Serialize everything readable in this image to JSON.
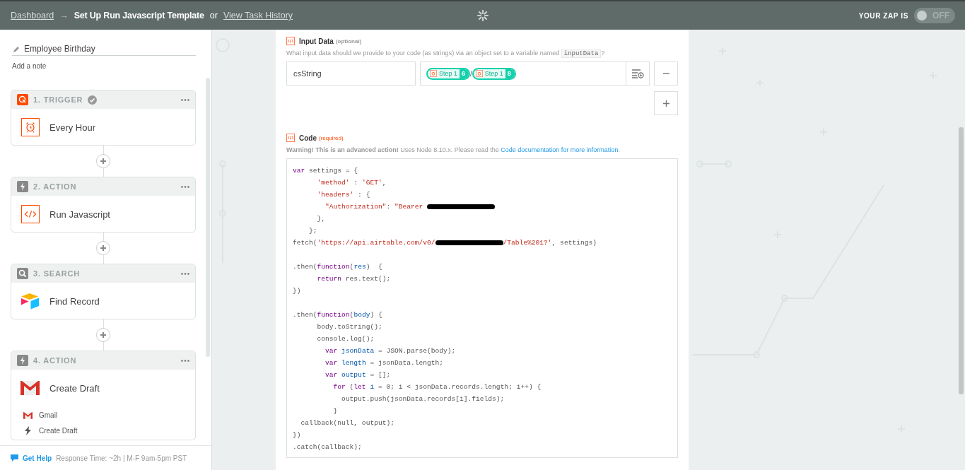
{
  "topbar": {
    "breadcrumb_link": "Dashboard",
    "arrow": "→",
    "title": "Set Up Run Javascript Template",
    "or": "or",
    "history_link": "View Task History",
    "status_label": "YOUR ZAP IS",
    "toggle": {
      "label": "OFF",
      "on": false
    }
  },
  "sidebar": {
    "zap_name": "Employee Birthday",
    "note_link": "Add a note",
    "steps": [
      {
        "kind": "trigger",
        "label": "1. TRIGGER",
        "complete": true,
        "app": {
          "kind": "schedule"
        },
        "title": "Every Hour"
      },
      {
        "kind": "action",
        "label": "2. ACTION",
        "complete": false,
        "app": {
          "kind": "code"
        },
        "title": "Run Javascript"
      },
      {
        "kind": "search",
        "label": "3. SEARCH",
        "complete": false,
        "app": {
          "kind": "airtable"
        },
        "title": "Find Record"
      },
      {
        "kind": "action",
        "label": "4. ACTION",
        "complete": false,
        "app": {
          "kind": "gmail"
        },
        "title": "Create Draft",
        "details": [
          {
            "kind": "gmail",
            "text": "Gmail"
          },
          {
            "kind": "bolt",
            "text": "Create Draft"
          }
        ]
      }
    ],
    "help": {
      "link": "Get Help",
      "text": "Response Time: ~2h | M-F 9am-5pm PST"
    }
  },
  "editor": {
    "input_data": {
      "title": "Input Data",
      "tag": "(optional)",
      "description": "What input data should we provide to your code (as strings) via an object set to a variable named ",
      "code": "inputData",
      "end": "?",
      "rows": [
        {
          "key": "csString",
          "tokens": [
            {
              "kind": "field",
              "label": "Step 1",
              "number": "6"
            },
            {
              "kind": "text",
              "text": "/"
            },
            {
              "kind": "field",
              "label": "Step 1",
              "number": "8"
            }
          ]
        }
      ]
    },
    "code": {
      "title": "Code",
      "tag": "(required)",
      "warning": "**Warning! This is an advanced action!** Uses Node 8.10.x. Please read the ",
      "link": "Code documentation for more information",
      "after": ".",
      "lines": [
        {
          "kind": "code",
          "tokens": [
            {
              "kind": "keyword",
              "text": "var"
            },
            {
              "kind": "plain",
              "text": " settings = {"
            }
          ]
        },
        {
          "kind": "code",
          "tokens": [
            {
              "kind": "string",
              "text": "      'method'"
            },
            {
              "kind": "plain",
              "text": " : "
            },
            {
              "kind": "string",
              "text": "'GET'"
            },
            {
              "kind": "plain",
              "text": ","
            }
          ]
        },
        {
          "kind": "code",
          "tokens": [
            {
              "kind": "string",
              "text": "      'headers'"
            },
            {
              "kind": "plain",
              "text": " : {"
            }
          ]
        },
        {
          "kind": "code",
          "tokens": [
            {
              "kind": "string",
              "text": "        \"Authorization\""
            },
            {
              "kind": "plain",
              "text": ": "
            },
            {
              "kind": "string",
              "text": "\"Bearer "
            },
            {
              "kind": "redacted"
            }
          ]
        },
        {
          "kind": "code",
          "tokens": [
            {
              "kind": "plain",
              "text": "      },"
            }
          ]
        },
        {
          "kind": "code",
          "tokens": [
            {
              "kind": "plain",
              "text": "    };"
            }
          ]
        },
        {
          "kind": "code",
          "tokens": [
            {
              "kind": "plain",
              "text": "fetch("
            },
            {
              "kind": "string",
              "text": "'https://api.airtable.com/v0/"
            },
            {
              "kind": "redacted"
            },
            {
              "kind": "string",
              "text": "/Table%201?'"
            },
            {
              "kind": "plain",
              "text": ", settings)"
            }
          ]
        },
        {
          "kind": "blank"
        },
        {
          "kind": "code",
          "tokens": [
            {
              "kind": "plain",
              "text": ".then("
            },
            {
              "kind": "keyword",
              "text": "function"
            },
            {
              "kind": "plain",
              "text": "("
            },
            {
              "kind": "variable",
              "text": "res"
            },
            {
              "kind": "plain",
              "text": ")  {"
            }
          ]
        },
        {
          "kind": "code",
          "tokens": [
            {
              "kind": "keyword",
              "text": "      return"
            },
            {
              "kind": "plain",
              "text": " res.text();"
            }
          ]
        },
        {
          "kind": "code",
          "tokens": [
            {
              "kind": "plain",
              "text": "})"
            }
          ]
        },
        {
          "kind": "blank"
        },
        {
          "kind": "code",
          "tokens": [
            {
              "kind": "plain",
              "text": ".then("
            },
            {
              "kind": "keyword",
              "text": "function"
            },
            {
              "kind": "plain",
              "text": "("
            },
            {
              "kind": "variable",
              "text": "body"
            },
            {
              "kind": "plain",
              "text": ") {"
            }
          ]
        },
        {
          "kind": "code",
          "tokens": [
            {
              "kind": "plain",
              "text": "      body.toString();"
            }
          ]
        },
        {
          "kind": "code",
          "tokens": [
            {
              "kind": "plain",
              "text": "      console.log();"
            }
          ]
        },
        {
          "kind": "code",
          "tokens": [
            {
              "kind": "keyword",
              "text": "        var "
            },
            {
              "kind": "variable",
              "text": "jsonData"
            },
            {
              "kind": "plain",
              "text": " = JSON.parse(body);"
            }
          ]
        },
        {
          "kind": "code",
          "tokens": [
            {
              "kind": "keyword",
              "text": "        var "
            },
            {
              "kind": "variable",
              "text": "length"
            },
            {
              "kind": "plain",
              "text": " = jsonData.length;"
            }
          ]
        },
        {
          "kind": "code",
          "tokens": [
            {
              "kind": "keyword",
              "text": "        var "
            },
            {
              "kind": "variable",
              "text": "output"
            },
            {
              "kind": "plain",
              "text": " = [];"
            }
          ]
        },
        {
          "kind": "code",
          "tokens": [
            {
              "kind": "keyword",
              "text": "          for"
            },
            {
              "kind": "plain",
              "text": " ("
            },
            {
              "kind": "keyword",
              "text": "let "
            },
            {
              "kind": "variable",
              "text": "i"
            },
            {
              "kind": "plain",
              "text": " = 0; i < jsonData.records.length; i++) {"
            }
          ]
        },
        {
          "kind": "code",
          "tokens": [
            {
              "kind": "plain",
              "text": "            output.push(jsonData.records[i].fields);"
            }
          ]
        },
        {
          "kind": "code",
          "tokens": [
            {
              "kind": "plain",
              "text": "          }"
            }
          ]
        },
        {
          "kind": "code",
          "tokens": [
            {
              "kind": "plain",
              "text": "  callback(null, output);"
            }
          ]
        },
        {
          "kind": "code",
          "tokens": [
            {
              "kind": "plain",
              "text": "})"
            }
          ]
        },
        {
          "kind": "code",
          "tokens": [
            {
              "kind": "plain",
              "text": ".catch(callback);"
            }
          ]
        }
      ]
    }
  }
}
